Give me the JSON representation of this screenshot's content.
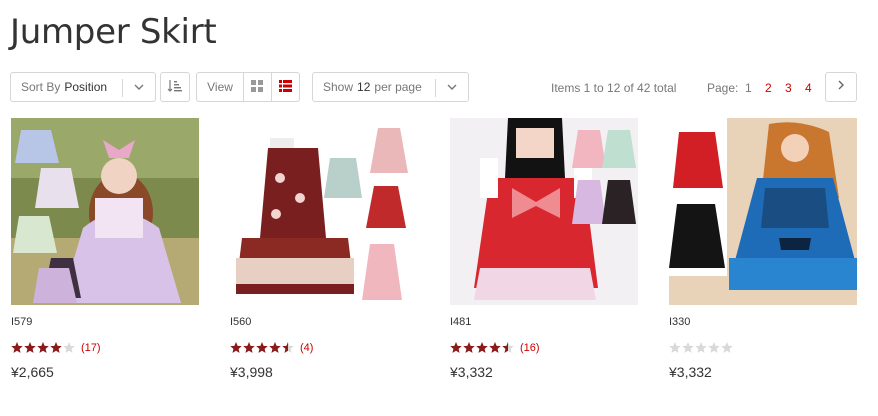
{
  "page": {
    "title": "Jumper Skirt"
  },
  "toolbar": {
    "sort_prefix": "Sort By",
    "sort_value": "Position",
    "view_label": "View",
    "show_prefix": "Show",
    "show_value": "12",
    "show_suffix": "per page",
    "items_total": "Items 1 to 12 of 42 total",
    "pager_label": "Page:",
    "pages": [
      "1",
      "2",
      "3",
      "4"
    ],
    "current_page": "1"
  },
  "colors": {
    "accent": "#cc0000",
    "star": "#8b1a1a",
    "star_empty": "#d9d9d9",
    "border": "#d6d6d6"
  },
  "products": [
    {
      "name": "I579",
      "rating": 4,
      "count": "(17)",
      "price": "¥2,665"
    },
    {
      "name": "I560",
      "rating": 4.5,
      "count": "(4)",
      "price": "¥3,998"
    },
    {
      "name": "I481",
      "rating": 4.5,
      "count": "(16)",
      "price": "¥3,332"
    },
    {
      "name": "I330",
      "rating": 0,
      "count": "",
      "price": "¥3,332"
    }
  ]
}
